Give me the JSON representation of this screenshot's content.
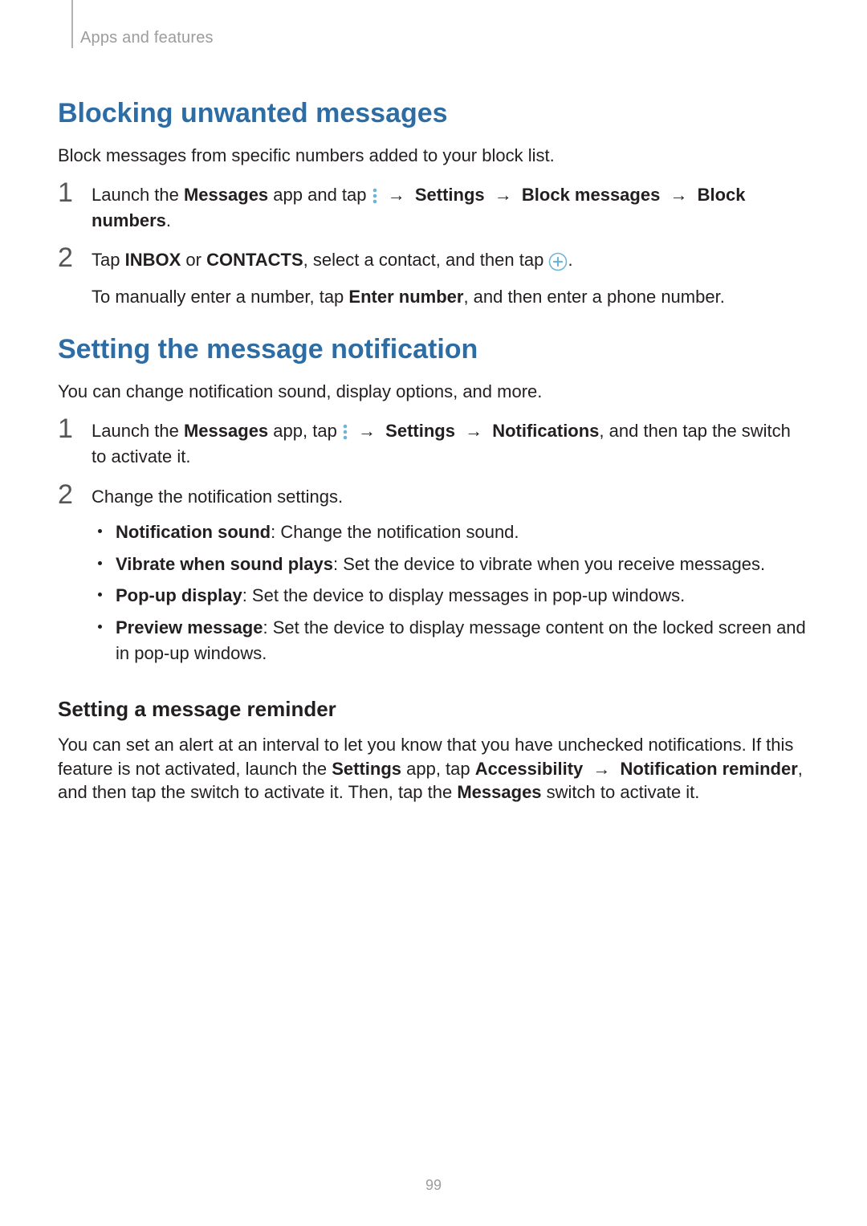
{
  "breadcrumb": "Apps and features",
  "section1": {
    "title": "Blocking unwanted messages",
    "lead": "Block messages from specific numbers added to your block list.",
    "step1": {
      "pre": "Launch the ",
      "app": "Messages",
      "mid": " app and tap ",
      "arrow1": " → ",
      "s1": "Settings",
      "arrow2": " → ",
      "s2": "Block messages",
      "arrow3": " → ",
      "s3": "Block numbers",
      "end": "."
    },
    "step2": {
      "pre": "Tap ",
      "inbox": "INBOX",
      "or": " or ",
      "contacts": "CONTACTS",
      "mid": ", select a contact, and then tap ",
      "end": ".",
      "note_pre": "To manually enter a number, tap ",
      "note_bold": "Enter number",
      "note_end": ", and then enter a phone number."
    }
  },
  "section2": {
    "title": "Setting the message notification",
    "lead": "You can change notification sound, display options, and more.",
    "step1": {
      "pre": "Launch the ",
      "app": "Messages",
      "mid": " app, tap ",
      "arrow1": " → ",
      "s1": "Settings",
      "arrow2": " → ",
      "s2": "Notifications",
      "end": ", and then tap the switch to activate it."
    },
    "step2": {
      "text": "Change the notification settings.",
      "b1_bold": "Notification sound",
      "b1_rest": ": Change the notification sound.",
      "b2_bold": "Vibrate when sound plays",
      "b2_rest": ": Set the device to vibrate when you receive messages.",
      "b3_bold": "Pop-up display",
      "b3_rest": ": Set the device to display messages in pop-up windows.",
      "b4_bold": "Preview message",
      "b4_rest": ": Set the device to display message content on the locked screen and in pop-up windows."
    }
  },
  "section3": {
    "title": "Setting a message reminder",
    "p_pre": "You can set an alert at an interval to let you know that you have unchecked notifications. If this feature is not activated, launch the ",
    "p_settings": "Settings",
    "p_mid1": " app, tap ",
    "p_access": "Accessibility",
    "p_arrow": " → ",
    "p_notifrem": "Notification reminder",
    "p_mid2": ", and then tap the switch to activate it. Then, tap the ",
    "p_messages": "Messages",
    "p_end": " switch to activate it."
  },
  "page_number": "99",
  "nums": {
    "n1": "1",
    "n2": "2"
  }
}
